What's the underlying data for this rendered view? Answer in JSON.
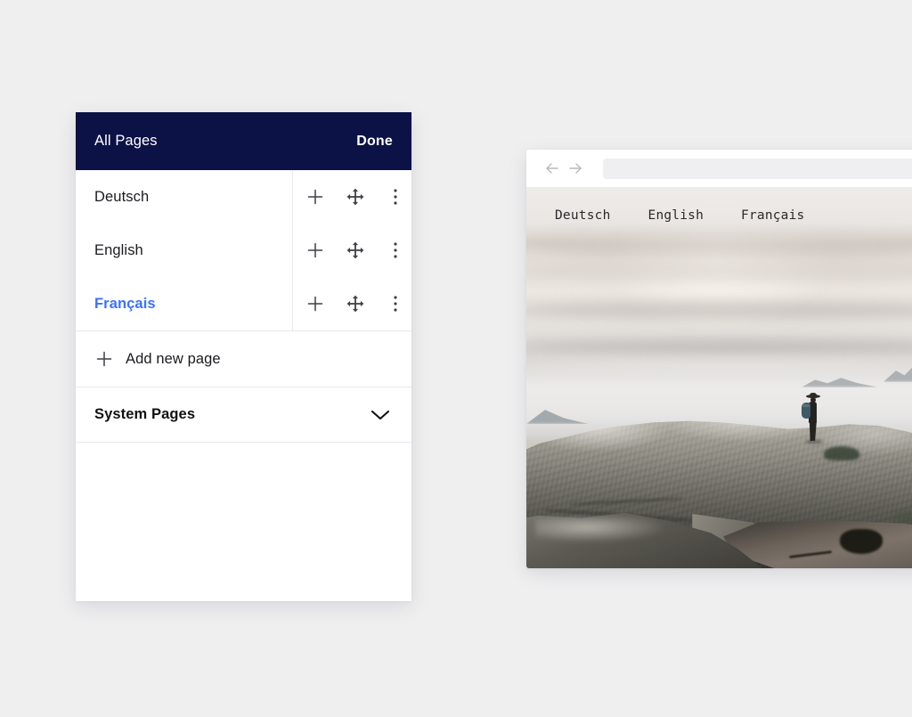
{
  "theme": {
    "background": "#efeff0",
    "panel_header_bg": "#0c1146",
    "accent_blue": "#3b71fe",
    "text_dark": "#1b1b1f",
    "divider": "#e9e9ec"
  },
  "pages_panel": {
    "header": {
      "title": "All Pages",
      "done_label": "Done"
    },
    "rows": [
      {
        "label": "Deutsch",
        "active": false
      },
      {
        "label": "English",
        "active": false
      },
      {
        "label": "Français",
        "active": true
      }
    ],
    "row_actions": {
      "add_icon": "plus-icon",
      "move_icon": "move-icon",
      "more_icon": "kebab-menu-icon"
    },
    "add_new": {
      "icon": "plus-icon",
      "label": "Add new page"
    },
    "system_pages": {
      "label": "System Pages",
      "icon": "chevron-down-icon",
      "expanded": false
    }
  },
  "browser": {
    "chrome": {
      "back_icon": "arrow-left-icon",
      "forward_icon": "arrow-right-icon",
      "url_value": "",
      "url_placeholder": ""
    },
    "site": {
      "nav_links": [
        {
          "label": "Deutsch"
        },
        {
          "label": "English"
        },
        {
          "label": "Français"
        }
      ],
      "hero_image": "mountain-summit-hiker-photo"
    }
  }
}
